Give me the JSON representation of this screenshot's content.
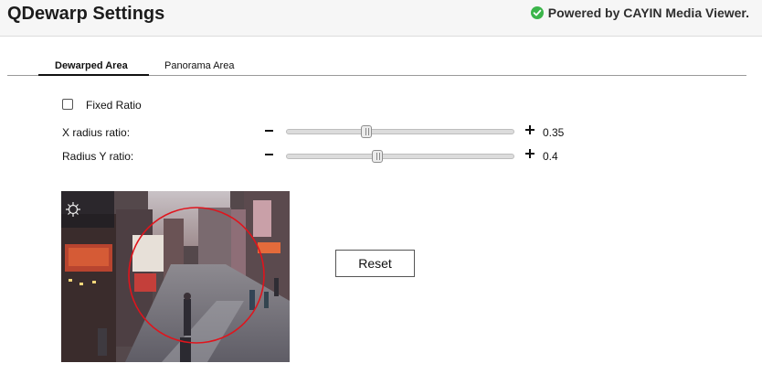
{
  "header": {
    "title": "QDewarp Settings",
    "powered_by": "Powered by CAYIN Media Viewer."
  },
  "tabs": [
    {
      "label": "Dewarped Area",
      "active": true
    },
    {
      "label": "Panorama Area",
      "active": false
    }
  ],
  "fixed_ratio": {
    "label": "Fixed Ratio",
    "checked": false
  },
  "sliders": {
    "x_radius": {
      "label": "X radius ratio:",
      "value": "0.35",
      "level": 0.35
    },
    "y_radius": {
      "label": "Radius Y ratio:",
      "value": "0.4",
      "level": 0.4
    }
  },
  "reset_label": "Reset",
  "icons": {
    "status": "check-circle-icon",
    "decrement": "minus-icon",
    "increment": "plus-icon",
    "overlay": "sun-icon"
  },
  "colors": {
    "status_green": "#3bb54a",
    "ellipse_red": "#e0141c"
  }
}
